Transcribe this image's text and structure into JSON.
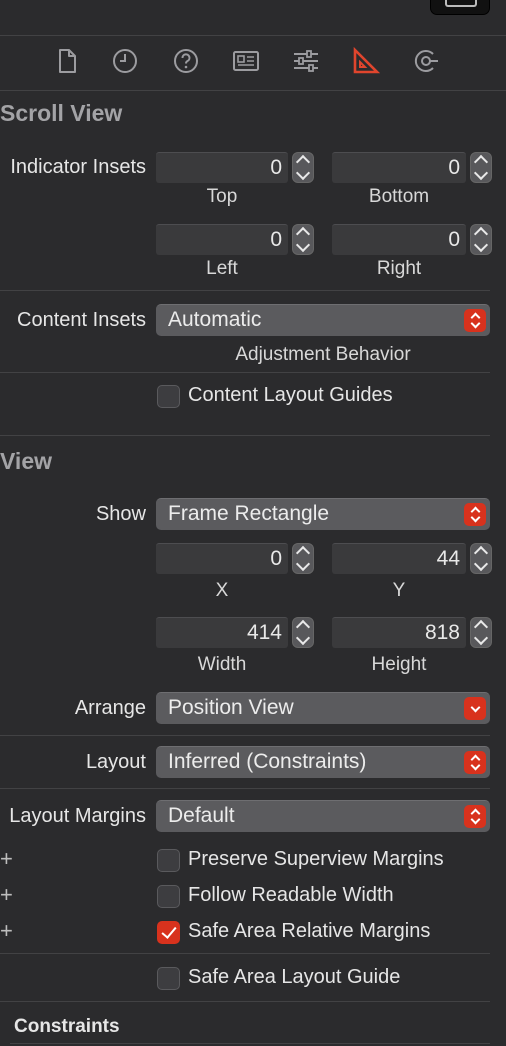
{
  "tabs": [
    {
      "icon": "file-inspector-icon"
    },
    {
      "icon": "history-inspector-icon"
    },
    {
      "icon": "quick-help-icon"
    },
    {
      "icon": "identity-inspector-icon"
    },
    {
      "icon": "attributes-inspector-icon"
    },
    {
      "icon": "size-inspector-icon",
      "active": true
    },
    {
      "icon": "connections-inspector-icon"
    }
  ],
  "accent_color": "#d8321d",
  "scroll_view": {
    "title": "Scroll View",
    "indicator_insets_label": "Indicator Insets",
    "top": {
      "value": "0",
      "label": "Top"
    },
    "bottom": {
      "value": "0",
      "label": "Bottom"
    },
    "left": {
      "value": "0",
      "label": "Left"
    },
    "right": {
      "value": "0",
      "label": "Right"
    },
    "content_insets_label": "Content Insets",
    "content_insets_value": "Automatic",
    "adjustment_behavior_label": "Adjustment Behavior",
    "content_layout_guides_label": "Content Layout Guides",
    "content_layout_guides_checked": false
  },
  "view": {
    "title": "View",
    "show_label": "Show",
    "show_value": "Frame Rectangle",
    "x": {
      "value": "0",
      "label": "X"
    },
    "y": {
      "value": "44",
      "label": "Y"
    },
    "width": {
      "value": "414",
      "label": "Width"
    },
    "height": {
      "value": "818",
      "label": "Height"
    },
    "arrange_label": "Arrange",
    "arrange_value": "Position View",
    "layout_label": "Layout",
    "layout_value": "Inferred (Constraints)",
    "layout_margins_label": "Layout Margins",
    "layout_margins_value": "Default",
    "preserve_superview_margins": {
      "label": "Preserve Superview Margins",
      "checked": false
    },
    "follow_readable_width": {
      "label": "Follow Readable Width",
      "checked": false
    },
    "safe_area_relative_margins": {
      "label": "Safe Area Relative Margins",
      "checked": true
    },
    "safe_area_layout_guide": {
      "label": "Safe Area Layout Guide",
      "checked": false
    }
  },
  "constraints": {
    "title": "Constraints"
  }
}
